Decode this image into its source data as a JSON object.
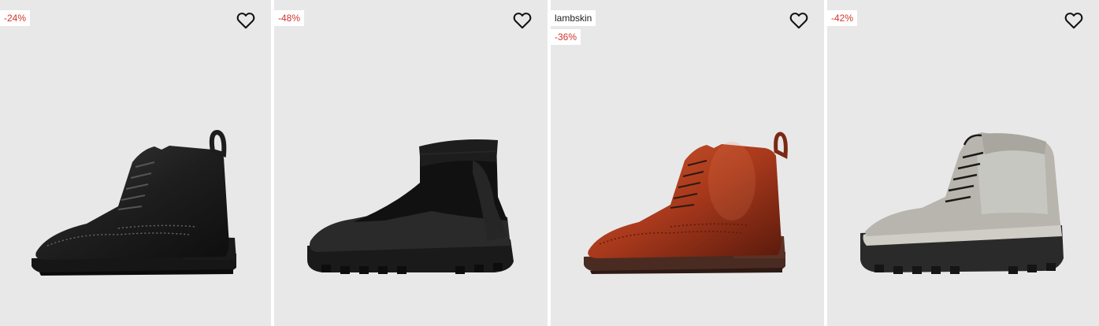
{
  "products": [
    {
      "badges": [
        {
          "type": "discount",
          "text": "-24%"
        }
      ],
      "wishlist_icon": "heart-outline-icon",
      "colors": {
        "upper": "#1d1d1d",
        "sole": "#161616"
      }
    },
    {
      "badges": [
        {
          "type": "discount",
          "text": "-48%"
        }
      ],
      "wishlist_icon": "heart-outline-icon",
      "colors": {
        "upper": "#151515",
        "sole": "#1a1a1a"
      }
    },
    {
      "badges": [
        {
          "type": "material",
          "text": "lambskin"
        },
        {
          "type": "discount",
          "text": "-36%"
        }
      ],
      "wishlist_icon": "heart-outline-icon",
      "colors": {
        "upper": "#a9391c",
        "sole": "#4a2b22"
      }
    },
    {
      "badges": [
        {
          "type": "discount",
          "text": "-42%"
        }
      ],
      "wishlist_icon": "heart-outline-icon",
      "colors": {
        "upper": "#b7b5ad",
        "sole": "#2a2a2a"
      }
    }
  ],
  "theme": {
    "card_background": "#e8e8e8",
    "discount_color": "#d0342c"
  }
}
